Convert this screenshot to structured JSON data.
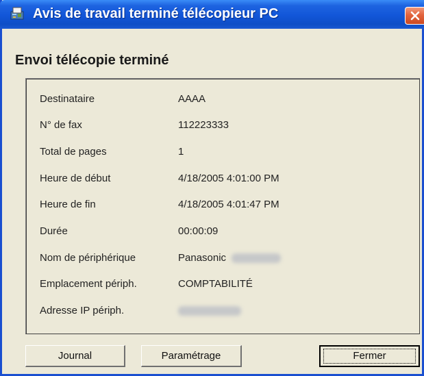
{
  "window": {
    "title": "Avis de travail terminé télécopieur PC",
    "icon": "fax-app-icon",
    "close_icon": "close-icon"
  },
  "heading": "Envoi télécopie terminé",
  "fields": [
    {
      "label": "Destinataire",
      "value": "AAAA"
    },
    {
      "label": "N° de fax",
      "value": "112223333"
    },
    {
      "label": "Total de pages",
      "value": "1"
    },
    {
      "label": "Heure de début",
      "value": "4/18/2005 4:01:00 PM"
    },
    {
      "label": "Heure de fin",
      "value": "4/18/2005 4:01:47 PM"
    },
    {
      "label": "Durée",
      "value": "00:00:09"
    },
    {
      "label": "Nom de périphérique",
      "value": "Panasonic"
    },
    {
      "label": "Emplacement périph.",
      "value": "COMPTABILITÉ"
    },
    {
      "label": "Adresse IP périph.",
      "value": ""
    }
  ],
  "buttons": {
    "journal": "Journal",
    "parametrage": "Paramétrage",
    "fermer": "Fermer"
  },
  "colors": {
    "titlebar": "#1256d8",
    "dialog_bg": "#ece9d8",
    "close_button": "#e2643d"
  }
}
